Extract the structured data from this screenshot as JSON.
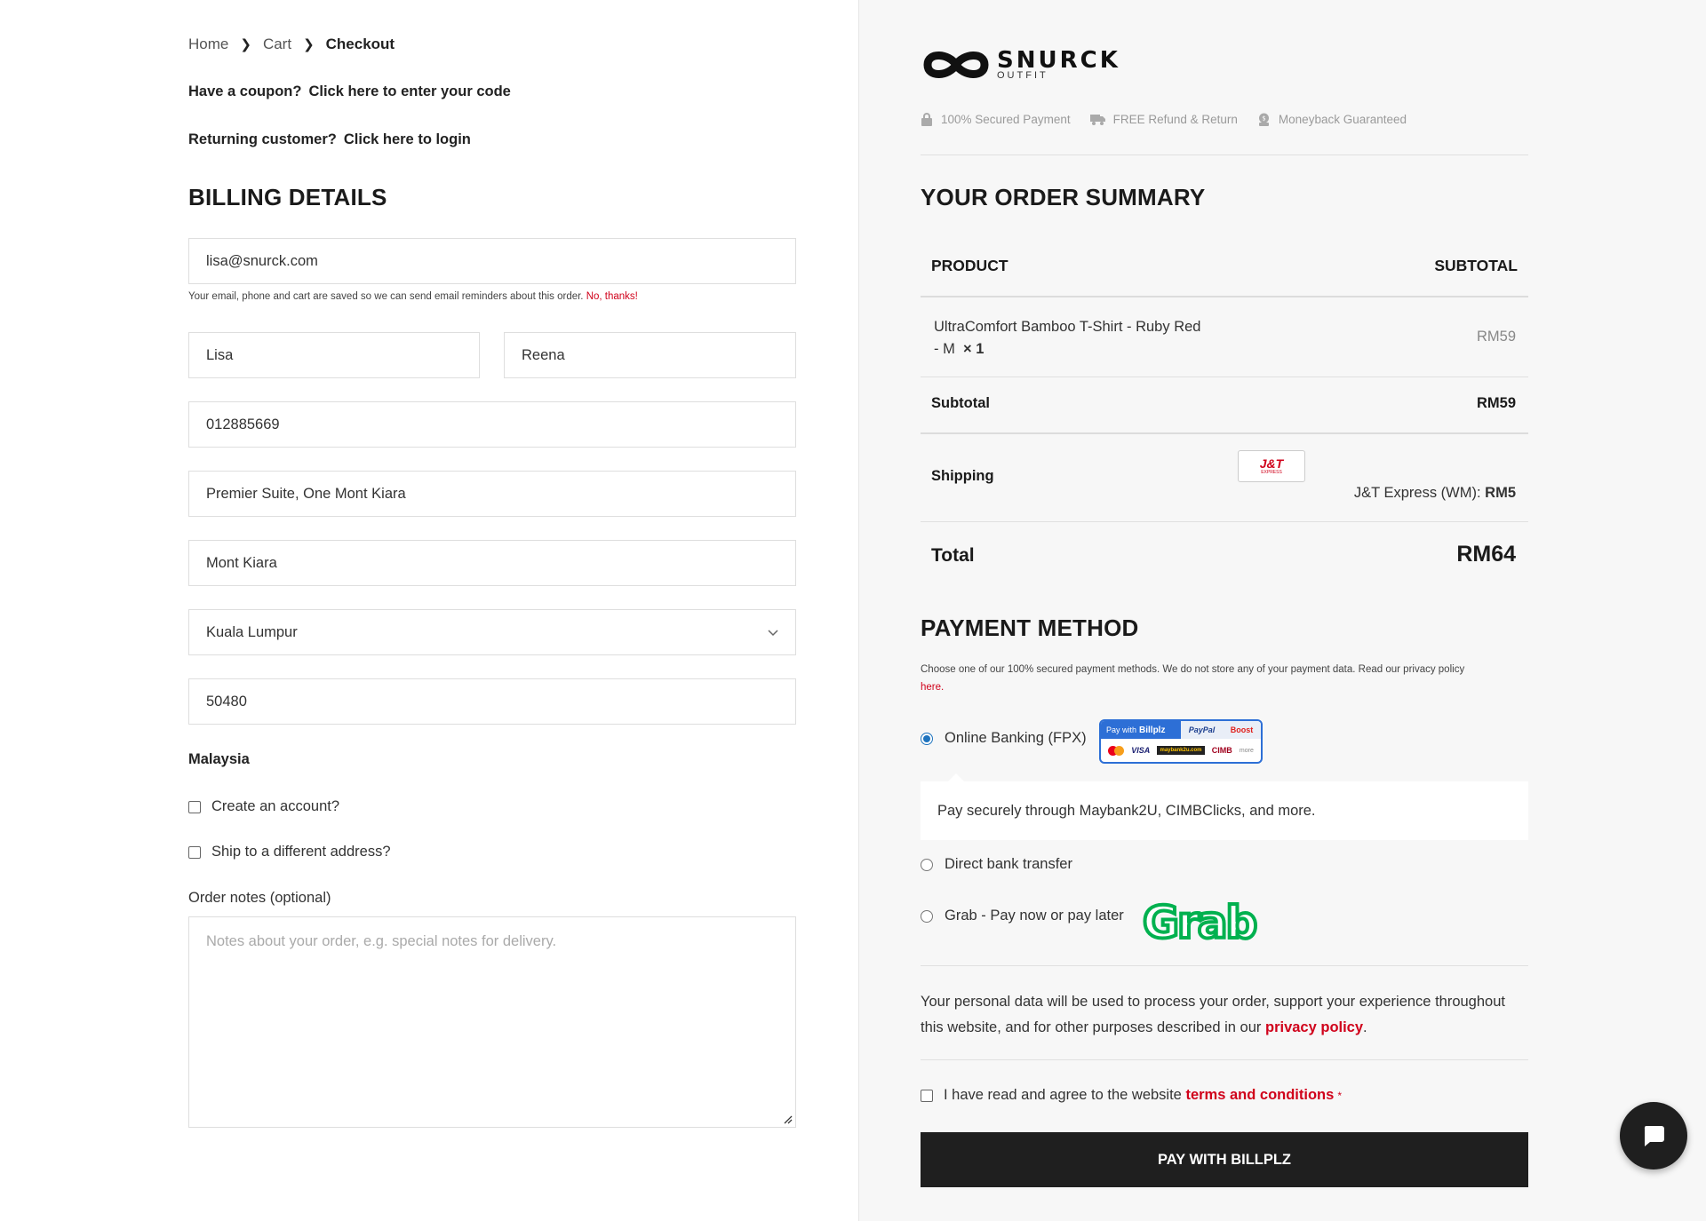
{
  "breadcrumb": {
    "home": "Home",
    "cart": "Cart",
    "current": "Checkout"
  },
  "notices": {
    "coupon_q": "Have a coupon?",
    "coupon_link": "Click here to enter your code",
    "login_q": "Returning customer?",
    "login_link": "Click here to login"
  },
  "billing": {
    "title": "BILLING DETAILS",
    "email": "lisa@snurck.com",
    "email_hint": "Your email, phone and cart are saved so we can send email reminders about this order.",
    "email_hint_link": "No, thanks!",
    "first_name": "Lisa",
    "last_name": "Reena",
    "phone": "012885669",
    "address": "Premier Suite, One Mont Kiara",
    "city": "Mont Kiara",
    "state": "Kuala Lumpur",
    "postcode": "50480",
    "country": "Malaysia",
    "create_account": "Create an account?",
    "ship_different": "Ship to a different address?",
    "notes_label": "Order notes (optional)",
    "notes_placeholder": "Notes about your order, e.g. special notes for delivery."
  },
  "brand": {
    "name": "SNURCK",
    "sub": "OUTFIT"
  },
  "trust": [
    "100% Secured Payment",
    "FREE Refund & Return",
    "Moneyback Guaranteed"
  ],
  "summary": {
    "title": "YOUR ORDER SUMMARY",
    "col_product": "PRODUCT",
    "col_subtotal": "SUBTOTAL",
    "product_name": "UltraComfort Bamboo T-Shirt - Ruby Red",
    "product_variant": "- M",
    "product_qty_x": "×",
    "product_qty": "1",
    "product_price": "RM59",
    "subtotal_label": "Subtotal",
    "subtotal_value": "RM59",
    "shipping_label": "Shipping",
    "shipping_logo_main": "J&T",
    "shipping_logo_sub": "EXPRESS",
    "shipping_method": "J&T Express (WM):",
    "shipping_value": "RM5",
    "total_label": "Total",
    "total_value": "RM64"
  },
  "payment": {
    "title": "PAYMENT METHOD",
    "desc": "Choose one of our 100% secured payment methods. We do not store any of your payment data. Read our privacy policy",
    "desc_link": "here.",
    "options": [
      {
        "label": "Online Banking (FPX)",
        "selected": true
      },
      {
        "label": "Direct bank transfer",
        "selected": false
      },
      {
        "label": "Grab - Pay now or pay later",
        "selected": false
      }
    ],
    "billplz_pay": "Pay with",
    "billplz_brand": "Billplz",
    "billplz_paypal": "PayPal",
    "billplz_boost": "Boost",
    "billplz_visa": "VISA",
    "billplz_m2u": "maybank2u.com",
    "billplz_cimb": "CIMB",
    "billplz_more": "more",
    "fpx_info": "Pay securely through Maybank2U, CIMBClicks, and more.",
    "grab_logo": "Grab"
  },
  "privacy": {
    "text": "Your personal data will be used to process your order, support your experience throughout this website, and for other purposes described in our",
    "link": "privacy policy",
    "end": "."
  },
  "terms": {
    "text": "I have read and agree to the website",
    "link": "terms and conditions",
    "star": "*"
  },
  "pay_button": "PAY WITH BILLPLZ",
  "colors": {
    "accent_red": "#d0021b",
    "radio_blue": "#1e73be",
    "button_dark": "#1f1f1f",
    "grab_green": "#00b14f"
  }
}
